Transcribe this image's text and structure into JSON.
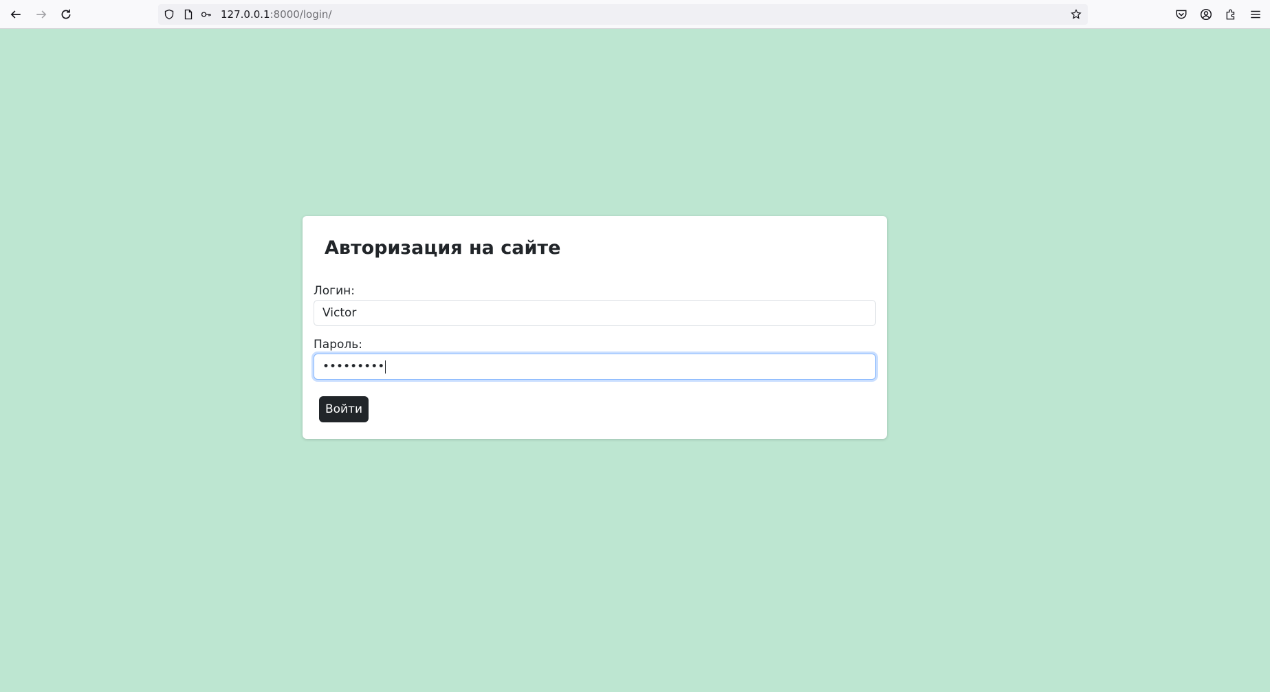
{
  "browser": {
    "url_host": "127.0.0.1",
    "url_rest": ":8000/login/",
    "icons": {
      "back": "back-arrow-icon",
      "forward": "forward-arrow-icon",
      "reload": "reload-icon",
      "shield": "shield-icon",
      "page": "page-icon",
      "key": "key-icon",
      "bookmark": "star-icon",
      "pocket": "pocket-icon",
      "account": "account-icon",
      "extensions": "extensions-icon",
      "menu": "hamburger-menu-icon"
    }
  },
  "login_form": {
    "title": "Авторизация на сайте",
    "username_label": "Логин:",
    "username_value": "Victor",
    "password_label": "Пароль:",
    "password_value": "•••••••••",
    "submit_label": "Войти"
  },
  "colors": {
    "page_background": "#bde6d1",
    "card_background": "#ffffff",
    "button_background": "#212529",
    "focus_ring": "#86b7fe"
  }
}
